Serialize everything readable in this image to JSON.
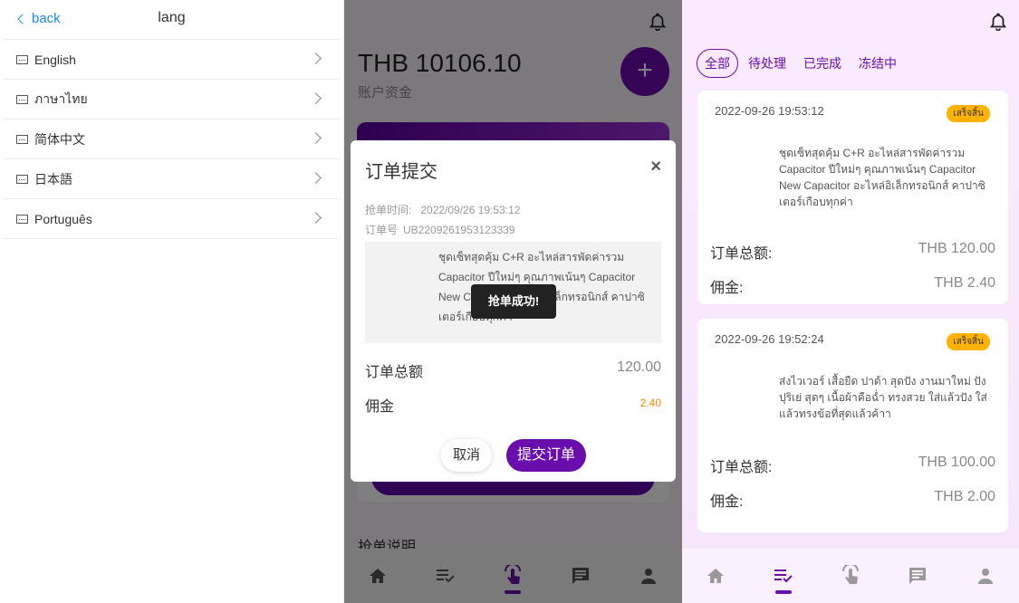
{
  "language_page": {
    "back_label": "back",
    "title": "lang",
    "languages": [
      "English",
      "ภาษาไทย",
      "简体中文",
      "日本語",
      "Português"
    ]
  },
  "submit_page": {
    "balance": "THB 10106.10",
    "balance_label": "账户资金",
    "plus_label": "+",
    "description_heading": "抢单说明",
    "modal": {
      "title": "订单提交",
      "close_label": "×",
      "grab_time_label": "抢单时间:",
      "grab_time_value": "2022/09/26 19:53:12",
      "order_no_label": "订单号",
      "order_no_value": "UB2209261953123339",
      "product_text": "ชุดเซ็ทสุดคุ้ม C+R อะไหล่สารพัดค่ารวม Capacitor ปีใหม่ๆ คุณภาพเน้นๆ Capacitor New Capacitor อะไหล่อิเล็กทรอนิกส์ คาปาซิเตอร์เกือบทุกค่า",
      "toast": "抢单成功!",
      "total_label": "订单总额",
      "total_value": "120.00",
      "commission_label": "佣金",
      "commission_value": "2.40",
      "cancel_label": "取消",
      "submit_label": "提交订单"
    }
  },
  "orders_page": {
    "filters": [
      "全部",
      "待处理",
      "已完成",
      "冻结中"
    ],
    "active_filter": 0,
    "orders": [
      {
        "time": "2022-09-26 19:53:12",
        "status": "เสร็จสิ้น",
        "title": "ชุดเซ็ทสุดคุ้ม C+R อะไหล่สารพัดค่ารวม Capacitor ปีใหม่ๆ คุณภาพเน้นๆ Capacitor New Capacitor อะไหล่อิเล็กทรอนิกส์ คาปาซิเตอร์เกือบทุกค่า",
        "total_label": "订单总额:",
        "total_value": "THB 120.00",
        "commission_label": "佣金:",
        "commission_value": "THB 2.40"
      },
      {
        "time": "2022-09-26 19:52:24",
        "status": "เสร็จสิ้น",
        "title": "ส่งไวเวอร์ เสื้อยืด ปาด้า สุดปัง งานมาใหม่ ปังปุริเย่ สุดๆ เนื้อผ้าคือฉ่ำ ทรงสวย ใส่แล้วปัง ใส่แล้วทรงข้อที่สุดแล้วค้าา",
        "total_label": "订单总额:",
        "total_value": "THB 100.00",
        "commission_label": "佣金:",
        "commission_value": "THB 2.00"
      }
    ]
  },
  "tabs": [
    "home-icon",
    "orders-icon",
    "grab-icon",
    "message-icon",
    "user-icon"
  ],
  "colors": {
    "accent": "#6a0dad",
    "link": "#1989fa",
    "badge": "#ffb300",
    "orange": "#ff8a00"
  }
}
